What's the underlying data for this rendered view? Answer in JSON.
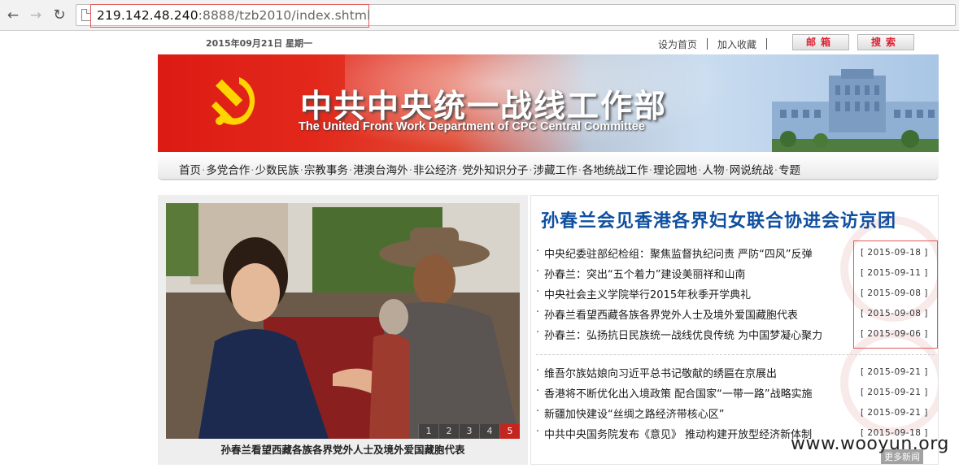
{
  "browser": {
    "url_host": "219.142.48.240",
    "url_rest": ":8888/tzb2010/index.shtml"
  },
  "topbar": {
    "date": "2015年09月21日  星期一",
    "set_home": "设为首页",
    "add_favorite": "加入收藏",
    "mail": "邮箱",
    "search": "搜索"
  },
  "banner": {
    "title_cn": "中共中央统一战线工作部",
    "title_en": "The United Front Work Department of CPC Central Committee"
  },
  "nav": {
    "items": [
      "首页",
      "多党合作",
      "少数民族",
      "宗教事务",
      "港澳台海外",
      "非公经济",
      "党外知识分子",
      "涉藏工作",
      "各地统战工作",
      "理论园地",
      "人物",
      "网说统战",
      "专题"
    ]
  },
  "feature": {
    "caption": "孙春兰看望西藏各族各界党外人士及境外爱国藏胞代表",
    "pages": [
      "1",
      "2",
      "3",
      "4",
      "5"
    ]
  },
  "news": {
    "headline": "孙春兰会见香港各界妇女联合协进会访京团",
    "list1": [
      {
        "title": "中央纪委驻部纪检组：聚焦监督执纪问责 严防“四风”反弹",
        "date": "[ 2015-09-18 ]"
      },
      {
        "title": "孙春兰：突出“五个着力”建设美丽祥和山南",
        "date": "[ 2015-09-11 ]"
      },
      {
        "title": "中央社会主义学院举行2015年秋季开学典礼",
        "date": "[ 2015-09-08 ]"
      },
      {
        "title": "孙春兰看望西藏各族各界党外人士及境外爱国藏胞代表",
        "date": "[ 2015-09-08 ]"
      },
      {
        "title": "孙春兰：弘扬抗日民族统一战线优良传统 为中国梦凝心聚力",
        "date": "[ 2015-09-06 ]"
      }
    ],
    "list2": [
      {
        "title": "维吾尔族姑娘向习近平总书记敬献的绣匾在京展出",
        "date": "[ 2015-09-21 ]"
      },
      {
        "title": "香港将不断优化出入境政策 配合国家“一带一路”战略实施",
        "date": "[ 2015-09-21 ]"
      },
      {
        "title": "新疆加快建设“丝绸之路经济带核心区”",
        "date": "[ 2015-09-21 ]"
      },
      {
        "title": "中共中央国务院发布《意见》 推动构建开放型经济新体制",
        "date": "[ 2015-09-18 ]"
      }
    ],
    "more": "更多新闻"
  },
  "watermark": "www.wooyun.org",
  "colors": {
    "banner_red": "#dc1b14",
    "headline_blue": "#0f4fa0",
    "highlight_box": "#e05a5a"
  }
}
